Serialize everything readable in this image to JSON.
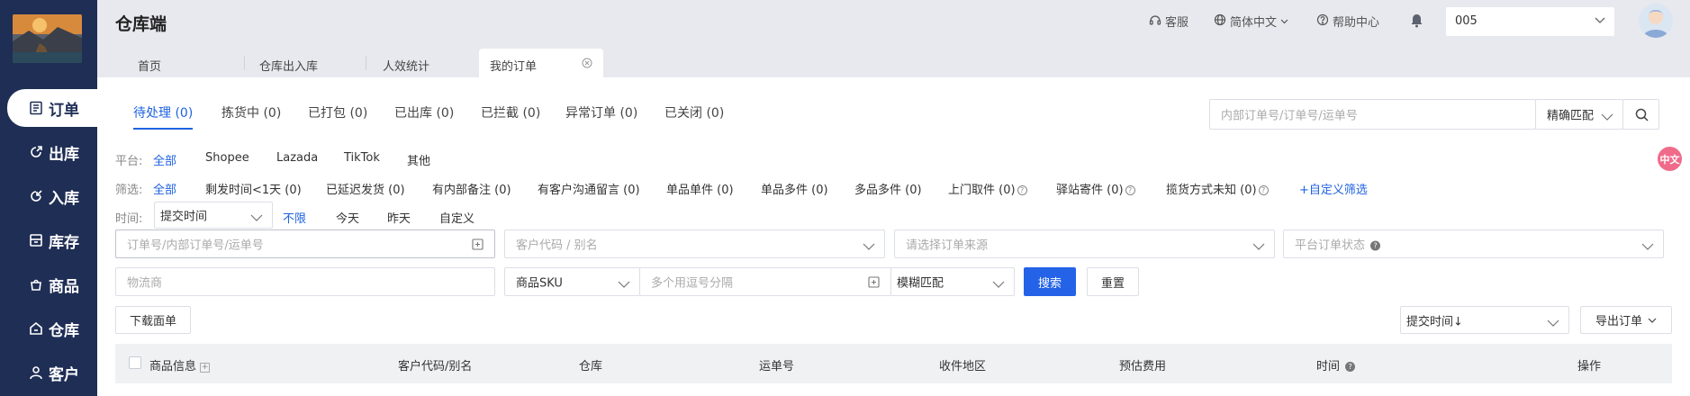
{
  "sidebar": {
    "items": [
      {
        "label": "订单",
        "icon": "order-icon",
        "active": true
      },
      {
        "label": "出库",
        "icon": "outbound-icon"
      },
      {
        "label": "入库",
        "icon": "inbound-icon"
      },
      {
        "label": "库存",
        "icon": "inventory-icon"
      },
      {
        "label": "商品",
        "icon": "product-icon"
      },
      {
        "label": "仓库",
        "icon": "warehouse-icon"
      },
      {
        "label": "客户",
        "icon": "customer-icon"
      }
    ]
  },
  "header": {
    "title": "仓库端",
    "service": "客服",
    "language": "简体中文",
    "help": "帮助中心",
    "tenant": "005"
  },
  "tabs": [
    "首页",
    "仓库出入库",
    "人效统计",
    "我的订单"
  ],
  "status_tabs": [
    "待处理 (0)",
    "拣货中 (0)",
    "已打包 (0)",
    "已出库 (0)",
    "已拦截 (0)",
    "异常订单 (0)",
    "已关闭 (0)"
  ],
  "search": {
    "placeholder": "内部订单号/订单号/运单号",
    "match_mode": "精确匹配"
  },
  "platform": {
    "label": "平台:",
    "options": [
      "全部",
      "Shopee",
      "Lazada",
      "TikTok",
      "其他"
    ]
  },
  "filter": {
    "label": "筛选:",
    "options": [
      "全部",
      "剩发时间<1天 (0)",
      "已延迟发货 (0)",
      "有内部备注 (0)",
      "有客户沟通留言 (0)",
      "单品单件 (0)",
      "单品多件 (0)",
      "多品多件 (0)",
      "上门取件 (0)",
      "驿站寄件 (0)",
      "揽货方式未知 (0)"
    ],
    "custom": "+自定义筛选"
  },
  "time": {
    "label": "时间:",
    "field": "提交时间",
    "options": [
      "不限",
      "今天",
      "昨天",
      "自定义"
    ]
  },
  "form": {
    "order_no_placeholder": "订单号/内部订单号/运单号",
    "customer_placeholder": "客户代码 / 别名",
    "source_placeholder": "请选择订单来源",
    "platform_status_placeholder": "平台订单状态",
    "carrier_placeholder": "物流商",
    "sku_field": "商品SKU",
    "multi_placeholder": "多个用逗号分隔",
    "fuzzy": "模糊匹配",
    "search_btn": "搜索",
    "reset_btn": "重置"
  },
  "toolbar": {
    "download": "下载面单",
    "sort": "提交时间↓",
    "export": "导出订单"
  },
  "table": {
    "columns": [
      "商品信息",
      "客户代码/别名",
      "仓库",
      "运单号",
      "收件地区",
      "预估费用",
      "时间",
      "操作"
    ]
  },
  "badge": "中文"
}
